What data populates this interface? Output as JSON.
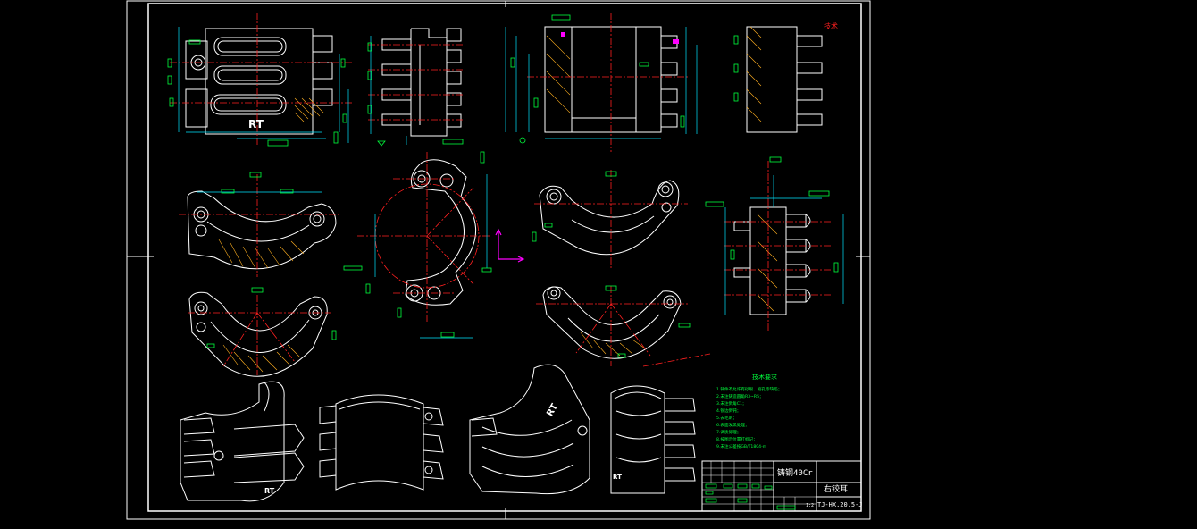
{
  "drawing": {
    "colors": {
      "background": "#000000",
      "outline": "#ffffff",
      "centerline": "#ff2020",
      "dimension": "#00e5ff",
      "annotation": "#00ff3c",
      "hatch": "#ffb020",
      "highlight": "#ff00ff",
      "notes_text": "#00ff3c"
    },
    "labels": {
      "logo_rt_front": "RT",
      "logo_rt_iso1": "RT",
      "logo_rt_iso3": "RT",
      "logo_rt_iso4": "RT",
      "corner_note": "技术"
    },
    "notes": {
      "title": "技术要求",
      "items": [
        "1.铸件不允许有砂眼、缩孔等缺陷；",
        "2.未注铸造圆角R3~R5；",
        "3.未注倒角C1；",
        "4.锐边倒钝；",
        "5.去毛刺；",
        "6.表面发黑处理；",
        "7.调质处理；",
        "8.按图示位置打标记；",
        "9.未注公差按GB/T1804-m"
      ]
    },
    "title_block": {
      "material": "铸钢40Cr",
      "part_name": "右铰耳",
      "drawing_no": "TJ-HX.20.5-J",
      "scale": "1:2"
    }
  }
}
